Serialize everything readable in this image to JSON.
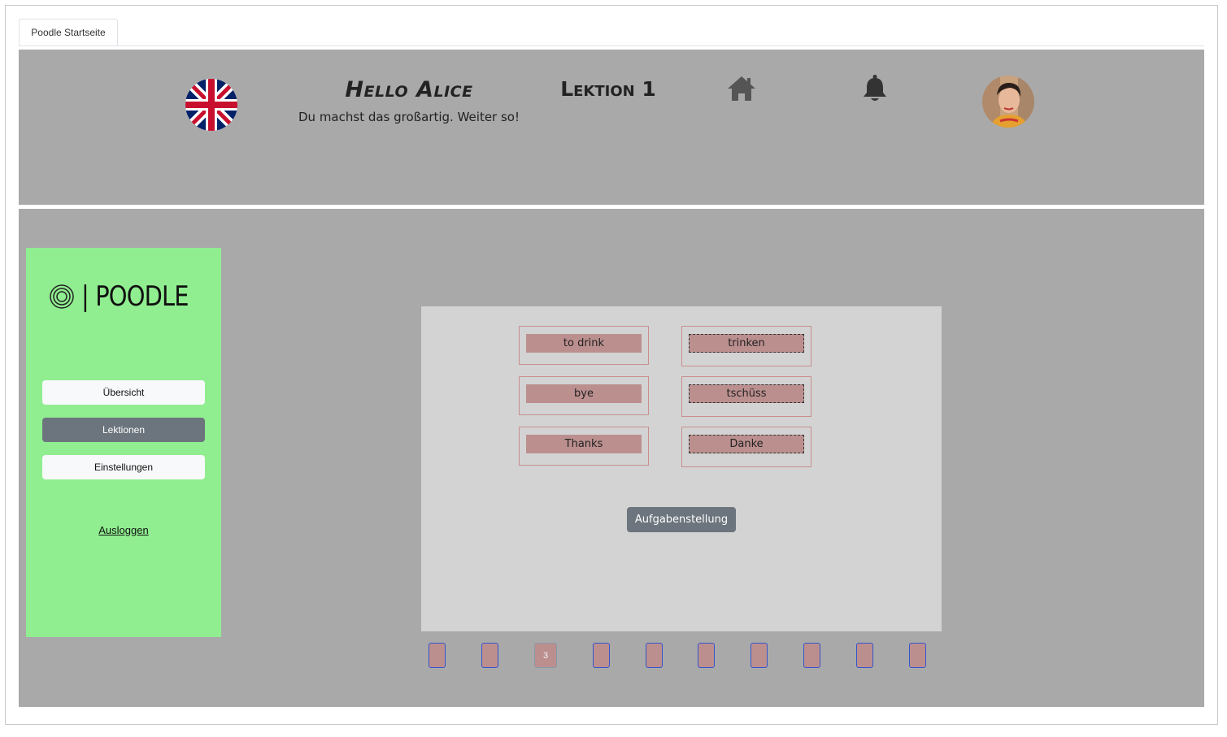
{
  "browser": {
    "tab_label": "Poodle Startseite"
  },
  "header": {
    "flag_icon": "uk-flag-icon",
    "greeting": "Hello Alice",
    "subtitle": "Du machst das großartig. Weiter so!",
    "lesson": "Lektion 1",
    "home_icon": "home-icon",
    "bell_icon": "bell-icon",
    "avatar": "user-avatar"
  },
  "sidebar": {
    "logo_text": "| POODLE",
    "items": [
      {
        "label": "Übersicht",
        "active": false
      },
      {
        "label": "Lektionen",
        "active": true
      },
      {
        "label": "Einstellungen",
        "active": false
      }
    ],
    "logout": "Ausloggen"
  },
  "exercise": {
    "rows": [
      {
        "left": "to drink",
        "right": "trinken"
      },
      {
        "left": "bye",
        "right": "tschüss"
      },
      {
        "left": "Thanks",
        "right": "Danke"
      }
    ],
    "task_button": "Aufgabenstellung"
  },
  "pagination": {
    "pages": [
      "",
      "",
      "3",
      "",
      "",
      "",
      "",
      "",
      "",
      ""
    ],
    "current_index": 2
  },
  "colors": {
    "panel_gray": "#a9a9a9",
    "card_gray": "#d3d3d3",
    "sidebar_green": "#90ee90",
    "word_rose": "#bc8f8f",
    "button_dark": "#6c757d"
  }
}
